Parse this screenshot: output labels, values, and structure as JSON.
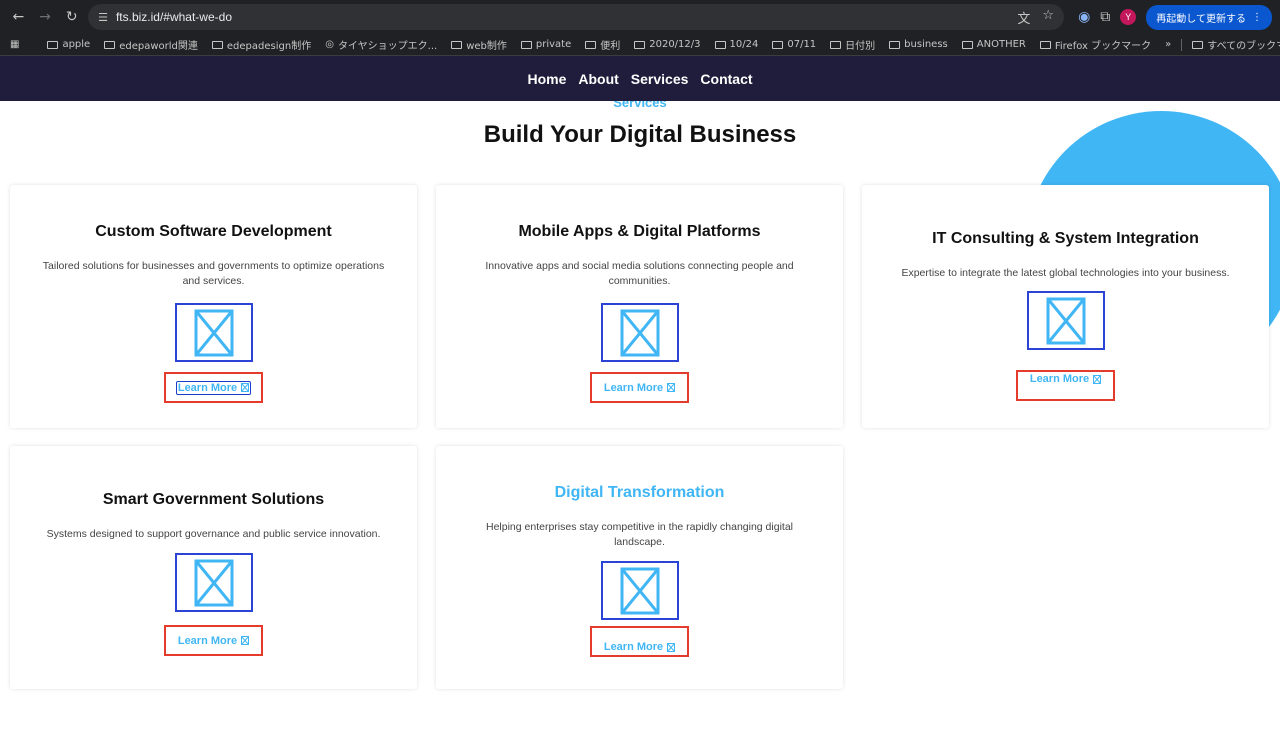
{
  "browser": {
    "url": "fts.biz.id/#what-we-do",
    "restart_label": "再起動して更新する",
    "avatar_letter": "Y",
    "bookmarks": [
      "apple",
      "edepaworld関連",
      "edepadesign制作",
      "タイヤショップエク...",
      "web制作",
      "private",
      "便利",
      "2020/12/3",
      "10/24",
      "07/11",
      "日付別",
      "business",
      "ANOTHER",
      "Firefox ブックマーク"
    ],
    "all_bookmarks_label": "すべてのブックマーク"
  },
  "nav": {
    "items": [
      "Home",
      "About",
      "Services",
      "Contact"
    ]
  },
  "section": {
    "eyebrow": "Services",
    "title": "Build Your Digital Business"
  },
  "cards": [
    {
      "title": "Custom Software Development",
      "desc": "Tailored solutions for businesses and governments to optimize operations and services.",
      "link": "Learn More"
    },
    {
      "title": "Mobile Apps & Digital Platforms",
      "desc": "Innovative apps and social media solutions connecting people and communities.",
      "link": "Learn More"
    },
    {
      "title": "IT Consulting & System Integration",
      "desc": "Expertise to integrate the latest global technologies into your business.",
      "link": "Learn More"
    },
    {
      "title": "Smart Government Solutions",
      "desc": "Systems designed to support governance and public service innovation.",
      "link": "Learn More"
    },
    {
      "title": "Digital Transformation",
      "desc": "Helping enterprises stay competitive in the rapidly changing digital landscape.",
      "link": "Learn More"
    }
  ],
  "colors": {
    "accent": "#41b6f5",
    "nav_bg": "#1f1d3b",
    "image_outline": "#2b44d6",
    "link_outline": "#e53b2c"
  }
}
